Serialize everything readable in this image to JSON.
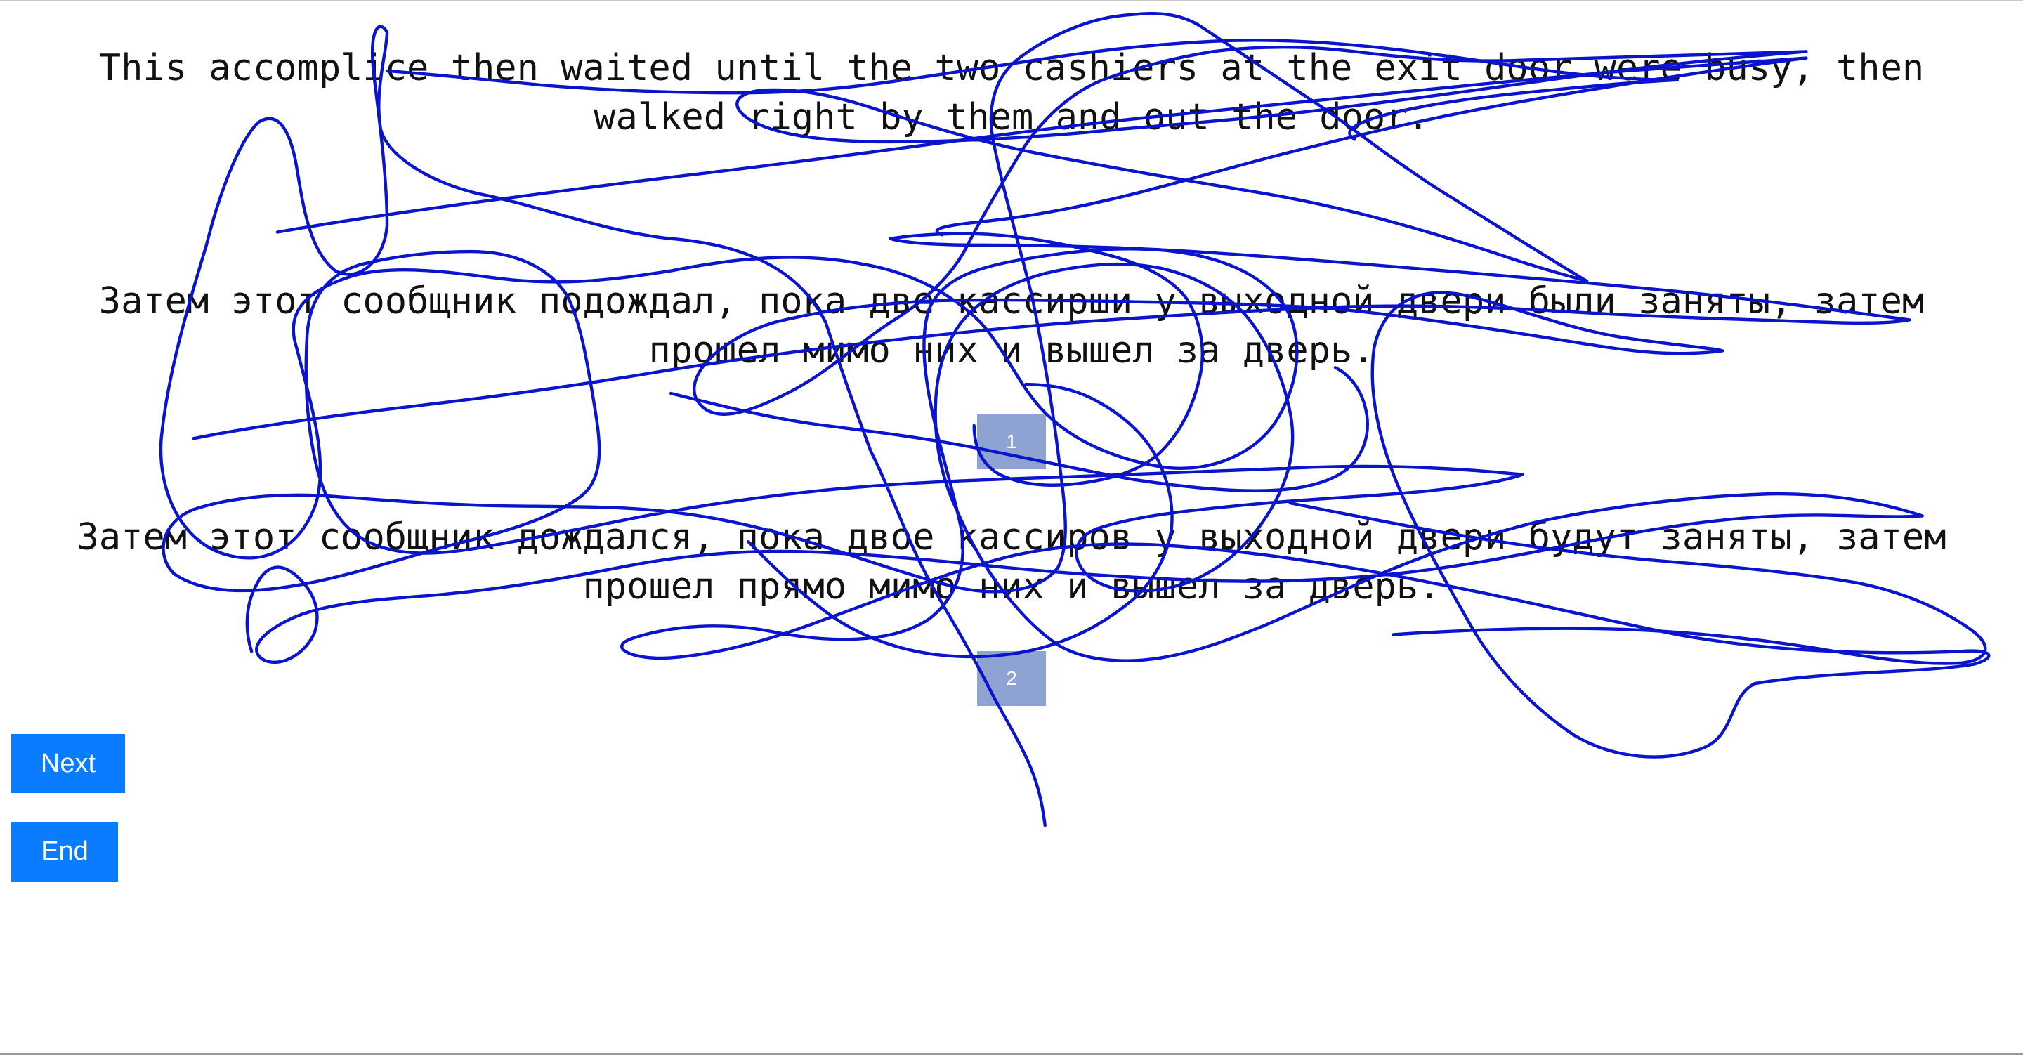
{
  "sentences": {
    "source": "This accomplice then waited until the two cashiers at the exit door were busy, then\nwalked right by them and out the door.",
    "translation_1": "Затем этот сообщник подождал, пока две кассирши у выходной двери были заняты, затем\nпрошел мимо них и вышел за дверь.",
    "translation_2": "Затем этот сообщник дождался, пока двое кассиров у выходной двери будут заняты, затем\nпрошел прямо мимо них и вышел за дверь."
  },
  "choices": {
    "badge_1": "1",
    "badge_2": "2"
  },
  "buttons": {
    "next": "Next",
    "end": "End"
  },
  "colors": {
    "button_bg": "#0a7cff",
    "badge_bg": "#8fa3d2",
    "scribble": "#0a14cc"
  }
}
